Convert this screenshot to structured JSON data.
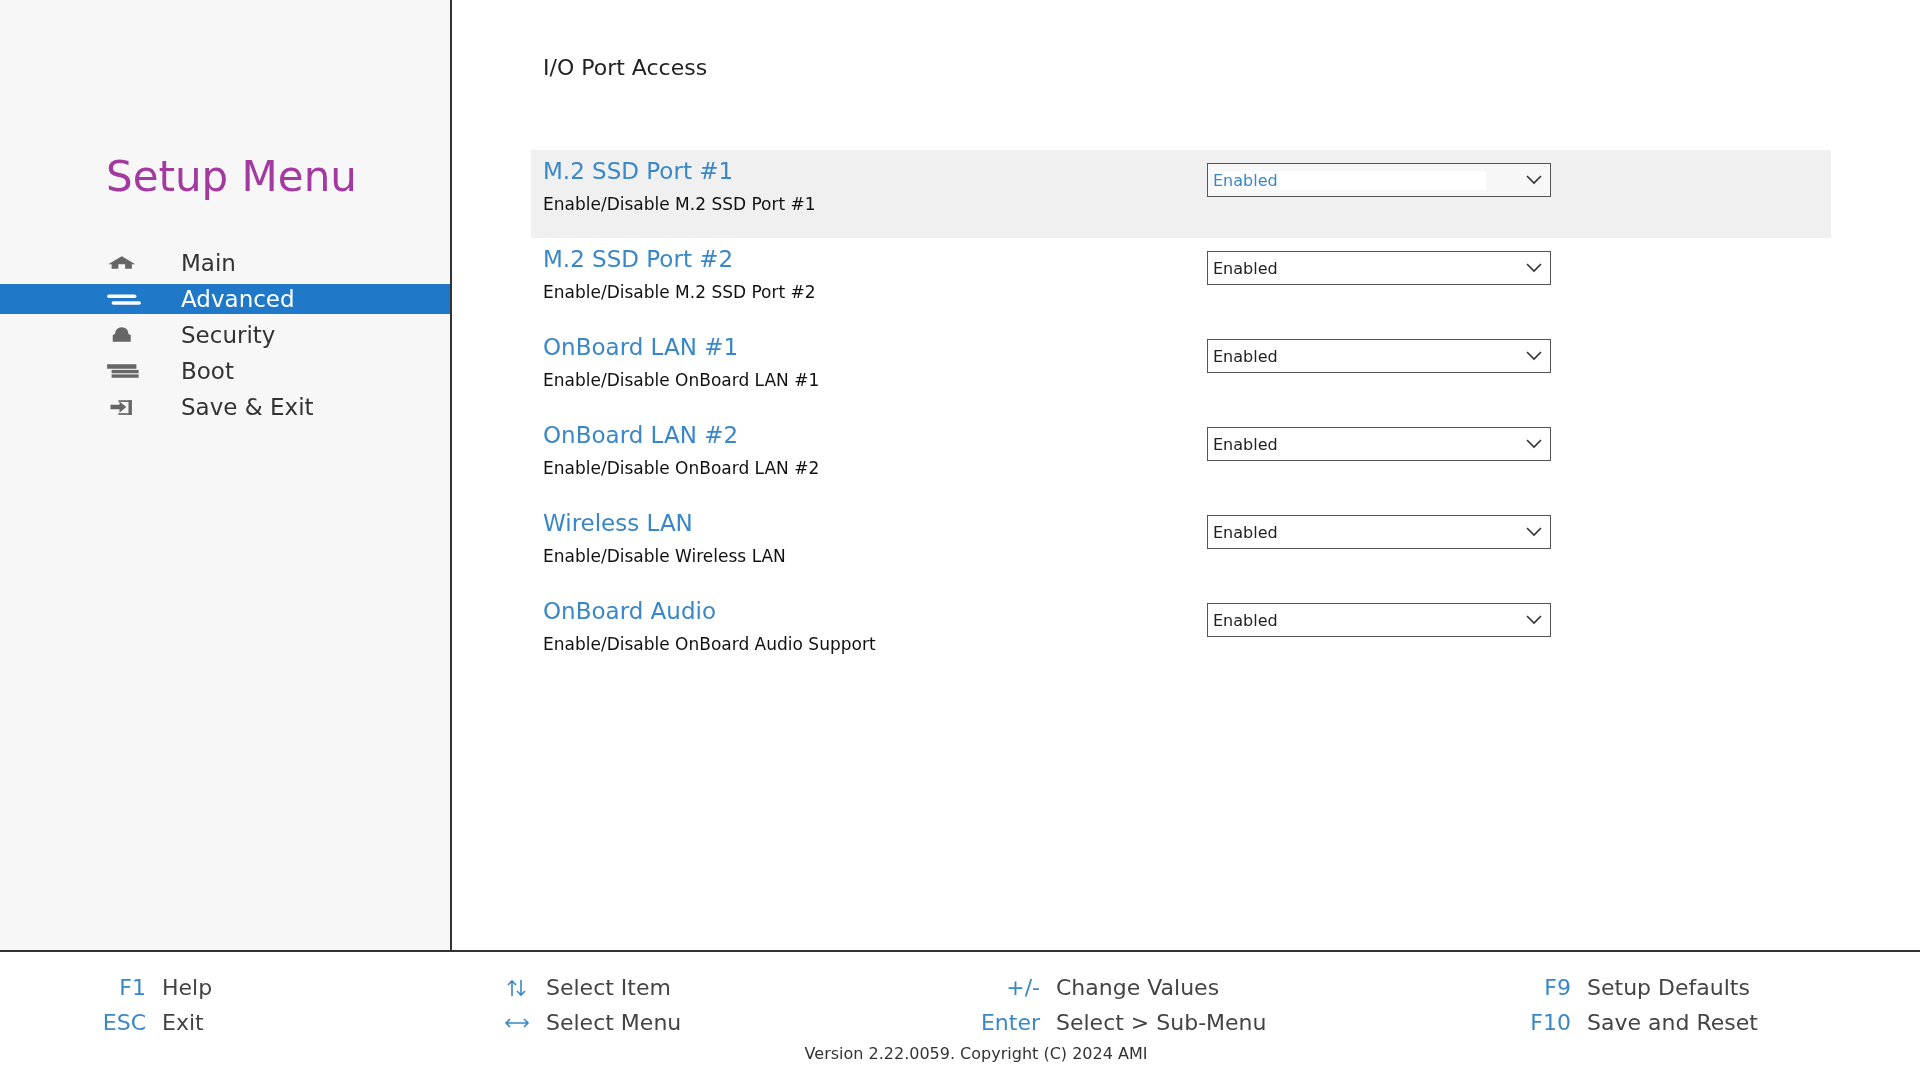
{
  "sidebar": {
    "title": "Setup Menu",
    "items": [
      {
        "label": "Main",
        "kind": "home",
        "selected": false
      },
      {
        "label": "Advanced",
        "kind": "lines",
        "selected": true
      },
      {
        "label": "Security",
        "kind": "lock",
        "selected": false
      },
      {
        "label": "Boot",
        "kind": "drive",
        "selected": false
      },
      {
        "label": "Save & Exit",
        "kind": "exit",
        "selected": false
      }
    ]
  },
  "page": {
    "title": "I/O Port Access",
    "settings": [
      {
        "label": "M.2 SSD Port #1",
        "description": "Enable/Disable M.2 SSD Port #1",
        "value": "Enabled",
        "selected": true
      },
      {
        "label": "M.2 SSD Port #2",
        "description": "Enable/Disable M.2 SSD Port #2",
        "value": "Enabled",
        "selected": false
      },
      {
        "label": "OnBoard LAN #1",
        "description": "Enable/Disable OnBoard LAN #1",
        "value": "Enabled",
        "selected": false
      },
      {
        "label": "OnBoard LAN #2",
        "description": "Enable/Disable OnBoard LAN #2",
        "value": "Enabled",
        "selected": false
      },
      {
        "label": "Wireless LAN",
        "description": "Enable/Disable Wireless LAN",
        "value": "Enabled",
        "selected": false
      },
      {
        "label": "OnBoard Audio",
        "description": "Enable/Disable OnBoard Audio Support",
        "value": "Enabled",
        "selected": false
      }
    ]
  },
  "footer": {
    "columns": [
      [
        {
          "kind": "key",
          "key": "F1",
          "label": "Help"
        },
        {
          "kind": "key",
          "key": "ESC",
          "label": "Exit"
        }
      ],
      [
        {
          "kind": "updown",
          "label": "Select Item"
        },
        {
          "kind": "leftright",
          "label": "Select Menu"
        }
      ],
      [
        {
          "kind": "key",
          "key": "+/-",
          "label": "Change Values"
        },
        {
          "kind": "key",
          "key": "Enter",
          "label": "Select > Sub-Menu"
        }
      ],
      [
        {
          "kind": "key",
          "key": "F9",
          "label": "Setup Defaults"
        },
        {
          "kind": "key",
          "key": "F10",
          "label": "Save and Reset"
        }
      ]
    ],
    "version": "Version 2.22.0059. Copyright (C) 2024 AMI"
  }
}
